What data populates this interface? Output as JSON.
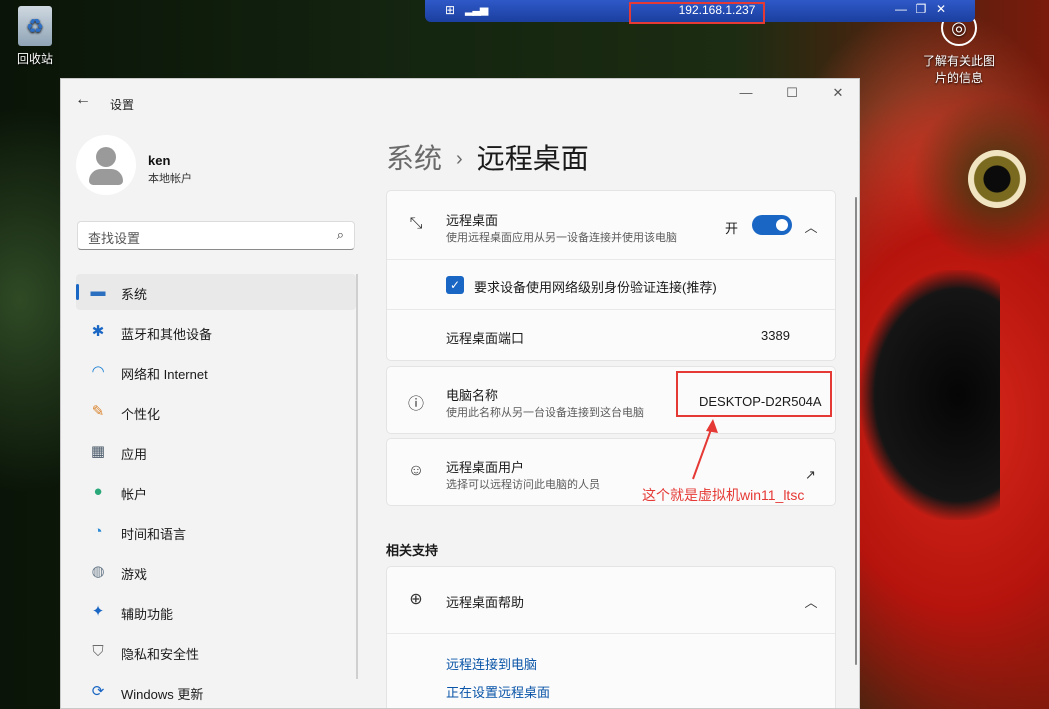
{
  "remote_bar": {
    "ip": "192.168.1.237",
    "pin": "⊞",
    "signal": "▂▃▅"
  },
  "desktop": {
    "recycle_bin": "回收站",
    "learn_more": "了解有关此图片的信息"
  },
  "window": {
    "title": "设置",
    "controls": {
      "minimize": "—",
      "maximize": "☐",
      "close": "✕"
    }
  },
  "profile": {
    "name": "ken",
    "type": "本地帐户"
  },
  "search": {
    "placeholder": "查找设置"
  },
  "nav": [
    {
      "label": "系统",
      "icon": "display-icon",
      "active": true
    },
    {
      "label": "蓝牙和其他设备",
      "icon": "bluetooth-icon"
    },
    {
      "label": "网络和 Internet",
      "icon": "wifi-icon"
    },
    {
      "label": "个性化",
      "icon": "brush-icon"
    },
    {
      "label": "应用",
      "icon": "apps-icon"
    },
    {
      "label": "帐户",
      "icon": "account-icon"
    },
    {
      "label": "时间和语言",
      "icon": "globe-clock-icon"
    },
    {
      "label": "游戏",
      "icon": "gamepad-icon"
    },
    {
      "label": "辅助功能",
      "icon": "accessibility-icon"
    },
    {
      "label": "隐私和安全性",
      "icon": "shield-icon"
    },
    {
      "label": "Windows 更新",
      "icon": "update-icon"
    }
  ],
  "breadcrumb": {
    "parent": "系统",
    "separator": "›",
    "current": "远程桌面"
  },
  "remote_desktop": {
    "title": "远程桌面",
    "subtitle": "使用远程桌面应用从另一设备连接并使用该电脑",
    "toggle_label": "开",
    "toggle_on": true,
    "nla_label": "要求设备使用网络级别身份验证连接(推荐)",
    "nla_checked": true,
    "port_label": "远程桌面端口",
    "port_value": "3389"
  },
  "pc_name": {
    "title": "电脑名称",
    "subtitle": "使用此名称从另一台设备连接到这台电脑",
    "value": "DESKTOP-D2R504A"
  },
  "users": {
    "title": "远程桌面用户",
    "subtitle": "选择可以远程访问此电脑的人员"
  },
  "annotation": "这个就是虚拟机win11_ltsc",
  "related": {
    "heading": "相关支持",
    "help_title": "远程桌面帮助",
    "links": [
      "远程连接到电脑",
      "正在设置远程桌面"
    ]
  },
  "colors": {
    "accent": "#1a66c4",
    "annotation": "#e53935",
    "rdp_bar": "#2f59c8"
  }
}
